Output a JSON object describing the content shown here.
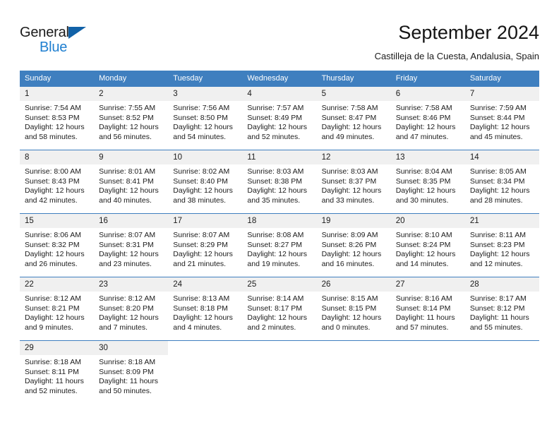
{
  "brand": {
    "name_part1": "General",
    "name_part2": "Blue",
    "triangle_color": "#1262a8",
    "blue_color": "#1f7fd0"
  },
  "header": {
    "title": "September 2024",
    "subtitle": "Castilleja de la Cuesta, Andalusia, Spain",
    "accent_color": "#3f7fbf",
    "daynum_band_color": "#f0f0f0"
  },
  "weekday_headers": [
    "Sunday",
    "Monday",
    "Tuesday",
    "Wednesday",
    "Thursday",
    "Friday",
    "Saturday"
  ],
  "weeks": [
    [
      {
        "day": "1",
        "sunrise": "Sunrise: 7:54 AM",
        "sunset": "Sunset: 8:53 PM",
        "daylight_line1": "Daylight: 12 hours",
        "daylight_line2": "and 58 minutes."
      },
      {
        "day": "2",
        "sunrise": "Sunrise: 7:55 AM",
        "sunset": "Sunset: 8:52 PM",
        "daylight_line1": "Daylight: 12 hours",
        "daylight_line2": "and 56 minutes."
      },
      {
        "day": "3",
        "sunrise": "Sunrise: 7:56 AM",
        "sunset": "Sunset: 8:50 PM",
        "daylight_line1": "Daylight: 12 hours",
        "daylight_line2": "and 54 minutes."
      },
      {
        "day": "4",
        "sunrise": "Sunrise: 7:57 AM",
        "sunset": "Sunset: 8:49 PM",
        "daylight_line1": "Daylight: 12 hours",
        "daylight_line2": "and 52 minutes."
      },
      {
        "day": "5",
        "sunrise": "Sunrise: 7:58 AM",
        "sunset": "Sunset: 8:47 PM",
        "daylight_line1": "Daylight: 12 hours",
        "daylight_line2": "and 49 minutes."
      },
      {
        "day": "6",
        "sunrise": "Sunrise: 7:58 AM",
        "sunset": "Sunset: 8:46 PM",
        "daylight_line1": "Daylight: 12 hours",
        "daylight_line2": "and 47 minutes."
      },
      {
        "day": "7",
        "sunrise": "Sunrise: 7:59 AM",
        "sunset": "Sunset: 8:44 PM",
        "daylight_line1": "Daylight: 12 hours",
        "daylight_line2": "and 45 minutes."
      }
    ],
    [
      {
        "day": "8",
        "sunrise": "Sunrise: 8:00 AM",
        "sunset": "Sunset: 8:43 PM",
        "daylight_line1": "Daylight: 12 hours",
        "daylight_line2": "and 42 minutes."
      },
      {
        "day": "9",
        "sunrise": "Sunrise: 8:01 AM",
        "sunset": "Sunset: 8:41 PM",
        "daylight_line1": "Daylight: 12 hours",
        "daylight_line2": "and 40 minutes."
      },
      {
        "day": "10",
        "sunrise": "Sunrise: 8:02 AM",
        "sunset": "Sunset: 8:40 PM",
        "daylight_line1": "Daylight: 12 hours",
        "daylight_line2": "and 38 minutes."
      },
      {
        "day": "11",
        "sunrise": "Sunrise: 8:03 AM",
        "sunset": "Sunset: 8:38 PM",
        "daylight_line1": "Daylight: 12 hours",
        "daylight_line2": "and 35 minutes."
      },
      {
        "day": "12",
        "sunrise": "Sunrise: 8:03 AM",
        "sunset": "Sunset: 8:37 PM",
        "daylight_line1": "Daylight: 12 hours",
        "daylight_line2": "and 33 minutes."
      },
      {
        "day": "13",
        "sunrise": "Sunrise: 8:04 AM",
        "sunset": "Sunset: 8:35 PM",
        "daylight_line1": "Daylight: 12 hours",
        "daylight_line2": "and 30 minutes."
      },
      {
        "day": "14",
        "sunrise": "Sunrise: 8:05 AM",
        "sunset": "Sunset: 8:34 PM",
        "daylight_line1": "Daylight: 12 hours",
        "daylight_line2": "and 28 minutes."
      }
    ],
    [
      {
        "day": "15",
        "sunrise": "Sunrise: 8:06 AM",
        "sunset": "Sunset: 8:32 PM",
        "daylight_line1": "Daylight: 12 hours",
        "daylight_line2": "and 26 minutes."
      },
      {
        "day": "16",
        "sunrise": "Sunrise: 8:07 AM",
        "sunset": "Sunset: 8:31 PM",
        "daylight_line1": "Daylight: 12 hours",
        "daylight_line2": "and 23 minutes."
      },
      {
        "day": "17",
        "sunrise": "Sunrise: 8:07 AM",
        "sunset": "Sunset: 8:29 PM",
        "daylight_line1": "Daylight: 12 hours",
        "daylight_line2": "and 21 minutes."
      },
      {
        "day": "18",
        "sunrise": "Sunrise: 8:08 AM",
        "sunset": "Sunset: 8:27 PM",
        "daylight_line1": "Daylight: 12 hours",
        "daylight_line2": "and 19 minutes."
      },
      {
        "day": "19",
        "sunrise": "Sunrise: 8:09 AM",
        "sunset": "Sunset: 8:26 PM",
        "daylight_line1": "Daylight: 12 hours",
        "daylight_line2": "and 16 minutes."
      },
      {
        "day": "20",
        "sunrise": "Sunrise: 8:10 AM",
        "sunset": "Sunset: 8:24 PM",
        "daylight_line1": "Daylight: 12 hours",
        "daylight_line2": "and 14 minutes."
      },
      {
        "day": "21",
        "sunrise": "Sunrise: 8:11 AM",
        "sunset": "Sunset: 8:23 PM",
        "daylight_line1": "Daylight: 12 hours",
        "daylight_line2": "and 12 minutes."
      }
    ],
    [
      {
        "day": "22",
        "sunrise": "Sunrise: 8:12 AM",
        "sunset": "Sunset: 8:21 PM",
        "daylight_line1": "Daylight: 12 hours",
        "daylight_line2": "and 9 minutes."
      },
      {
        "day": "23",
        "sunrise": "Sunrise: 8:12 AM",
        "sunset": "Sunset: 8:20 PM",
        "daylight_line1": "Daylight: 12 hours",
        "daylight_line2": "and 7 minutes."
      },
      {
        "day": "24",
        "sunrise": "Sunrise: 8:13 AM",
        "sunset": "Sunset: 8:18 PM",
        "daylight_line1": "Daylight: 12 hours",
        "daylight_line2": "and 4 minutes."
      },
      {
        "day": "25",
        "sunrise": "Sunrise: 8:14 AM",
        "sunset": "Sunset: 8:17 PM",
        "daylight_line1": "Daylight: 12 hours",
        "daylight_line2": "and 2 minutes."
      },
      {
        "day": "26",
        "sunrise": "Sunrise: 8:15 AM",
        "sunset": "Sunset: 8:15 PM",
        "daylight_line1": "Daylight: 12 hours",
        "daylight_line2": "and 0 minutes."
      },
      {
        "day": "27",
        "sunrise": "Sunrise: 8:16 AM",
        "sunset": "Sunset: 8:14 PM",
        "daylight_line1": "Daylight: 11 hours",
        "daylight_line2": "and 57 minutes."
      },
      {
        "day": "28",
        "sunrise": "Sunrise: 8:17 AM",
        "sunset": "Sunset: 8:12 PM",
        "daylight_line1": "Daylight: 11 hours",
        "daylight_line2": "and 55 minutes."
      }
    ],
    [
      {
        "day": "29",
        "sunrise": "Sunrise: 8:18 AM",
        "sunset": "Sunset: 8:11 PM",
        "daylight_line1": "Daylight: 11 hours",
        "daylight_line2": "and 52 minutes."
      },
      {
        "day": "30",
        "sunrise": "Sunrise: 8:18 AM",
        "sunset": "Sunset: 8:09 PM",
        "daylight_line1": "Daylight: 11 hours",
        "daylight_line2": "and 50 minutes."
      },
      {
        "day": "",
        "sunrise": "",
        "sunset": "",
        "daylight_line1": "",
        "daylight_line2": ""
      },
      {
        "day": "",
        "sunrise": "",
        "sunset": "",
        "daylight_line1": "",
        "daylight_line2": ""
      },
      {
        "day": "",
        "sunrise": "",
        "sunset": "",
        "daylight_line1": "",
        "daylight_line2": ""
      },
      {
        "day": "",
        "sunrise": "",
        "sunset": "",
        "daylight_line1": "",
        "daylight_line2": ""
      },
      {
        "day": "",
        "sunrise": "",
        "sunset": "",
        "daylight_line1": "",
        "daylight_line2": ""
      }
    ]
  ]
}
